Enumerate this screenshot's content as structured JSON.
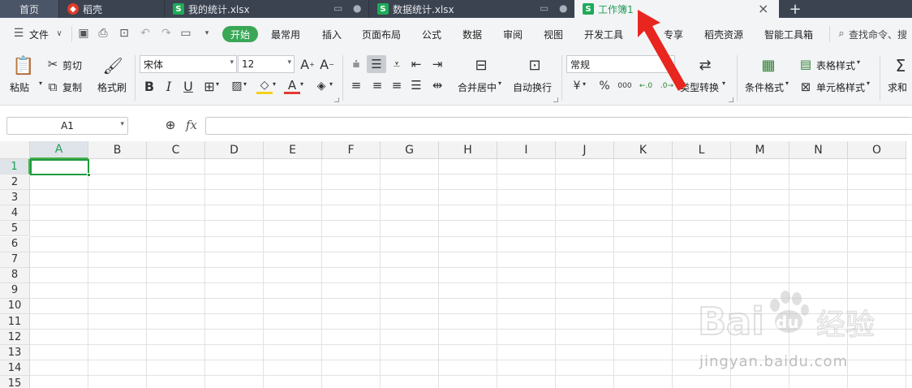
{
  "tabs": {
    "home": "首页",
    "items": [
      {
        "label": "稻壳",
        "badge": "red"
      },
      {
        "label": "我的统计.xlsx",
        "badge": "S"
      },
      {
        "label": "数据统计.xlsx",
        "badge": "S"
      },
      {
        "label": "工作簿1",
        "badge": "S",
        "active": true
      }
    ],
    "add": "+",
    "close": "×"
  },
  "menu": {
    "file": "文件",
    "start": "开始",
    "items": [
      "最常用",
      "插入",
      "页面布局",
      "公式",
      "数据",
      "审阅",
      "视图",
      "开发工具",
      "专享",
      "稻壳资源",
      "智能工具箱"
    ],
    "search_placeholder": "查找命令、搜"
  },
  "ribbon": {
    "paste": "粘贴",
    "cut": "剪切",
    "copy": "复制",
    "format_painter": "格式刷",
    "font_name": "宋体",
    "font_size": "12",
    "bold": "B",
    "italic": "I",
    "underline": "U",
    "merge_center": "合并居中",
    "wrap_text": "自动换行",
    "number_format": "常规",
    "currency": "¥",
    "percent": "%",
    "thousands": "000",
    "type_convert": "类型转换",
    "conditional_format": "条件格式",
    "table_style": "表格样式",
    "cell_style": "单元格样式",
    "sum": "求和"
  },
  "formula_bar": {
    "name_box": "A1",
    "fx": "fx"
  },
  "sheet": {
    "columns": [
      "A",
      "B",
      "C",
      "D",
      "E",
      "F",
      "G",
      "H",
      "I",
      "J",
      "K",
      "L",
      "M",
      "N",
      "O"
    ],
    "rows": [
      "1",
      "2",
      "3",
      "4",
      "5",
      "6",
      "7",
      "8",
      "9",
      "10",
      "11",
      "12",
      "13",
      "14",
      "15"
    ],
    "active_cell": "A1"
  },
  "watermark": {
    "brand": "Bai",
    "brand2": "du",
    "cn": "经验",
    "url": "jingyan.baidu.com"
  },
  "colors": {
    "accent": "#3aa757",
    "tabbar": "#3b4250",
    "annotation": "#e8251f"
  }
}
